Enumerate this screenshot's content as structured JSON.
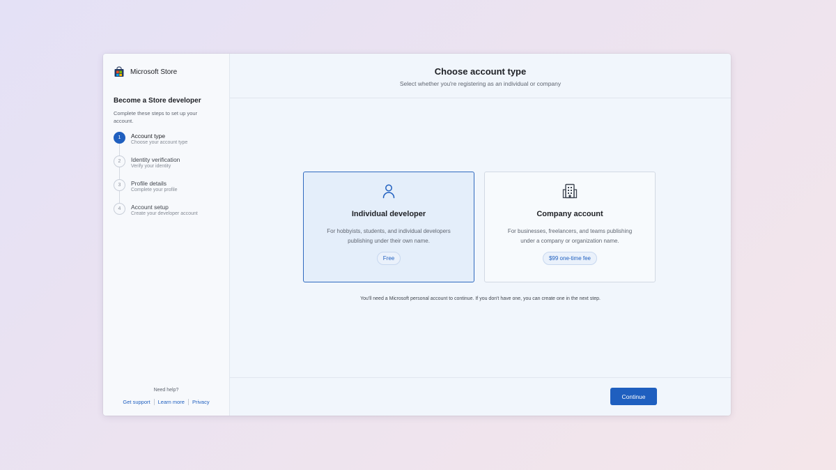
{
  "sidebar": {
    "brand": {
      "name": "Microsoft Store",
      "icon": "store-bag-icon"
    },
    "title": "Become a Store developer",
    "description": "Complete these steps to set up your account.",
    "steps": [
      {
        "number": "1",
        "title": "Account type",
        "subtitle": "Choose your account type",
        "active": true
      },
      {
        "number": "2",
        "title": "Identity verification",
        "subtitle": "Verify your identity",
        "active": false
      },
      {
        "number": "3",
        "title": "Profile details",
        "subtitle": "Complete your profile",
        "active": false
      },
      {
        "number": "4",
        "title": "Account setup",
        "subtitle": "Create your developer account",
        "active": false
      }
    ],
    "help": {
      "title": "Need help?",
      "links": [
        "Get support",
        "Learn more",
        "Privacy"
      ]
    }
  },
  "main": {
    "title": "Choose account type",
    "subtitle": "Select whether you're registering as an individual or company",
    "cards": [
      {
        "icon": "person-icon",
        "title": "Individual developer",
        "description": "For hobbyists, students, and individual developers publishing under their own name.",
        "badge": "Free",
        "selected": true
      },
      {
        "icon": "building-icon",
        "title": "Company account",
        "description": "For businesses, freelancers, and teams publishing under a company or organization name.",
        "badge": "$99 one-time fee",
        "selected": false
      }
    ],
    "note": "You'll need a Microsoft personal account to continue. If you don't have one, you can create one in the next step."
  },
  "footer": {
    "continue_label": "Continue"
  },
  "colors": {
    "accent": "#1f5fbf",
    "selected_card_bg": "#e4eefa"
  }
}
